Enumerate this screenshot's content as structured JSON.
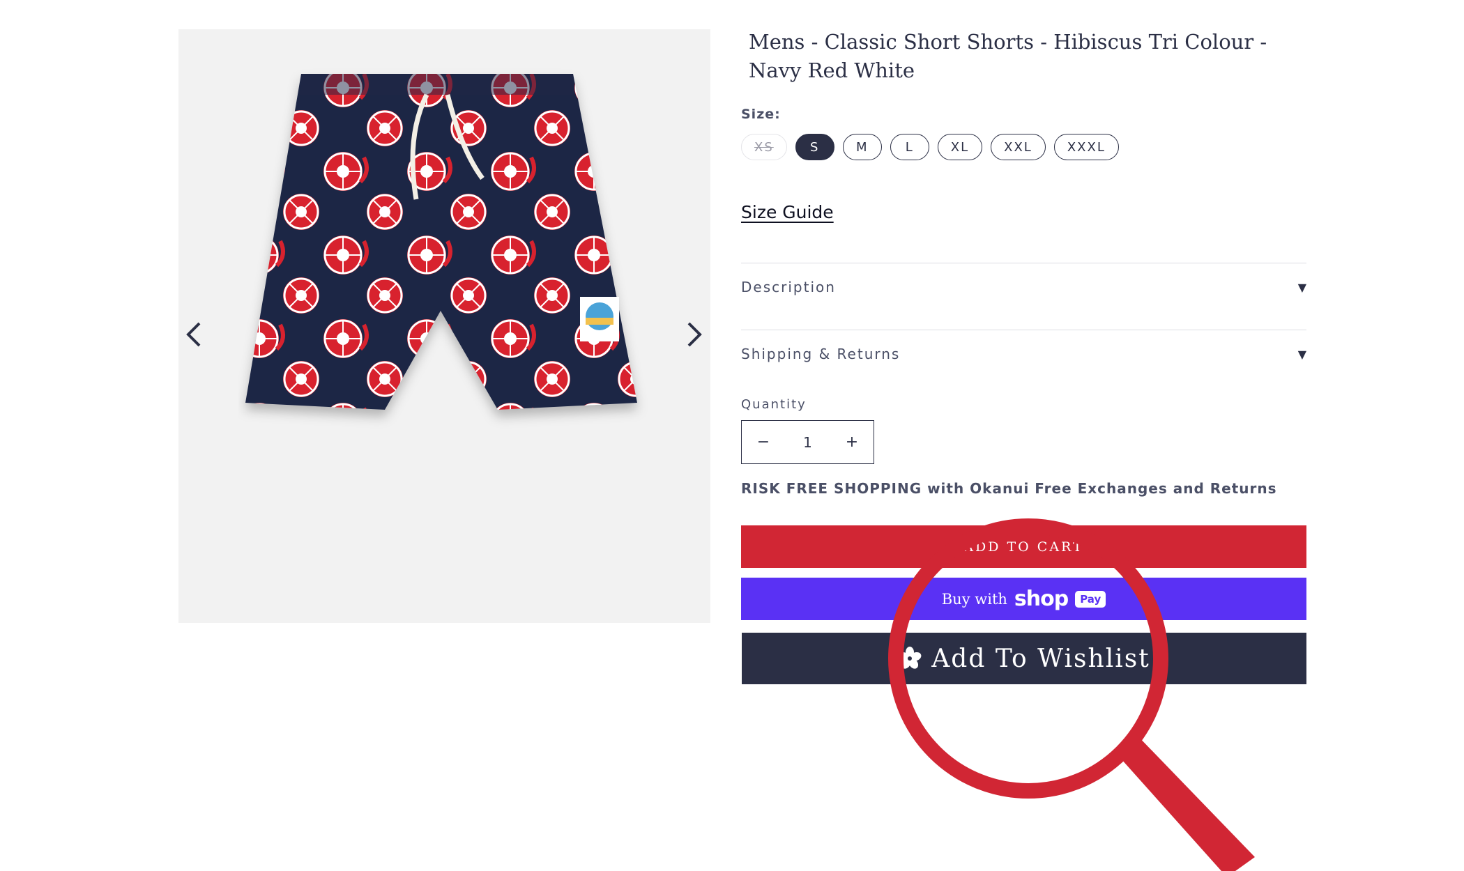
{
  "product": {
    "title": "Mens - Classic Short Shorts - Hibiscus Tri Colour - Navy Red White",
    "image_alt": "Hibiscus print short shorts"
  },
  "gallery": {
    "prev_icon": "chevron-left-icon",
    "next_icon": "chevron-right-icon"
  },
  "size": {
    "label": "Size:",
    "options": [
      {
        "label": "XS",
        "state": "unavailable"
      },
      {
        "label": "S",
        "state": "selected"
      },
      {
        "label": "M",
        "state": "available"
      },
      {
        "label": "L",
        "state": "available"
      },
      {
        "label": "XL",
        "state": "available"
      },
      {
        "label": "XXL",
        "state": "available"
      },
      {
        "label": "XXXL",
        "state": "available"
      }
    ]
  },
  "size_guide": "Size Guide",
  "accordions": [
    {
      "label": "Description",
      "icon": "caret-down-icon"
    },
    {
      "label": "Shipping & Returns",
      "icon": "caret-down-icon"
    }
  ],
  "quantity": {
    "label": "Quantity",
    "value": "1",
    "minus": "−",
    "plus": "+"
  },
  "risk_text": "RISK FREE SHOPPING with Okanui Free Exchanges and Returns",
  "buttons": {
    "add_to_cart": "ADD TO CART",
    "buy_with": "Buy with",
    "shop_word": "shop",
    "pay_badge": "Pay",
    "wishlist": "Add To Wishlist",
    "wishlist_icon": "hibiscus-flower-icon"
  },
  "colors": {
    "navy": "#2b2f45",
    "red": "#d12634",
    "shop_purple": "#5a31f4",
    "gallery_bg": "#f2f2f2"
  }
}
